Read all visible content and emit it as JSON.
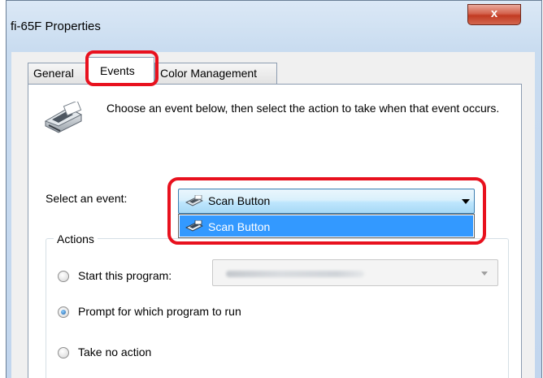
{
  "window": {
    "title": "fi-65F Properties",
    "close_label": "x"
  },
  "tabs": [
    {
      "label": "General",
      "active": false
    },
    {
      "label": "Events",
      "active": true
    },
    {
      "label": "Color Management",
      "active": false
    }
  ],
  "intro_text": "Choose an event below, then select the action to take when that event occurs.",
  "event": {
    "label": "Select an event:",
    "selected": "Scan Button",
    "options": [
      "Scan Button"
    ]
  },
  "actions": {
    "group_title": "Actions",
    "start_program_label": "Start this program:",
    "start_program_value": "",
    "prompt_label": "Prompt for which program to run",
    "no_action_label": "Take no action",
    "selected": "prompt"
  },
  "colors": {
    "highlight": "#e8111e",
    "selection": "#3399ff",
    "combo_border": "#3c7fb1"
  },
  "icons": {
    "scanner": "scanner-icon",
    "scan_button": "scan-button-icon",
    "close": "close-icon"
  }
}
